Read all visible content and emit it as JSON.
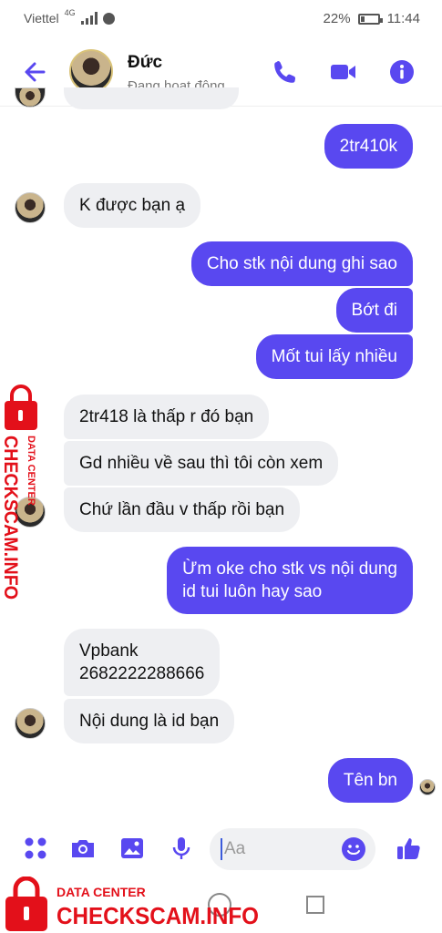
{
  "status": {
    "carrier": "Viettel",
    "network": "4G",
    "battery_percent": "22%",
    "battery_level": 0.22,
    "time": "11:44"
  },
  "header": {
    "name": "Đức",
    "status": "Đang hoạt động"
  },
  "messages": [
    {
      "dir": "out",
      "text": "2tr410k"
    },
    {
      "dir": "in",
      "text": "K được bạn ạ"
    },
    {
      "dir": "out",
      "text": "Cho stk nội dung ghi sao"
    },
    {
      "dir": "out",
      "text": "Bớt đi"
    },
    {
      "dir": "out",
      "text": "Mốt tui lấy nhiều"
    },
    {
      "dir": "in",
      "text": "2tr418 là thấp r đó bạn"
    },
    {
      "dir": "in",
      "text": "Gd nhiều về sau thì tôi còn xem"
    },
    {
      "dir": "in",
      "text": "Chứ lần đầu v thấp rồi bạn"
    },
    {
      "dir": "out",
      "line1": "Ừm oke cho stk vs nội dung",
      "line2": "id tui luôn hay sao"
    },
    {
      "dir": "in",
      "line1": "Vpbank",
      "line2": "2682222288666"
    },
    {
      "dir": "in",
      "text": "Nội dung là id bạn"
    },
    {
      "dir": "out",
      "text": "Tên bn"
    }
  ],
  "composer": {
    "placeholder": "Aa"
  },
  "watermark": {
    "line1": "DATA CENTER",
    "line2": "CHECKSCAM.INFO"
  },
  "colors": {
    "accent": "#5948f0",
    "incoming_bg": "#eeeff2",
    "watermark": "#e3101a"
  },
  "icons": [
    "back-arrow-icon",
    "phone-icon",
    "video-camera-icon",
    "info-icon",
    "apps-icon",
    "camera-icon",
    "image-icon",
    "microphone-icon",
    "emoji-icon",
    "thumbs-up-icon",
    "lock-icon"
  ]
}
